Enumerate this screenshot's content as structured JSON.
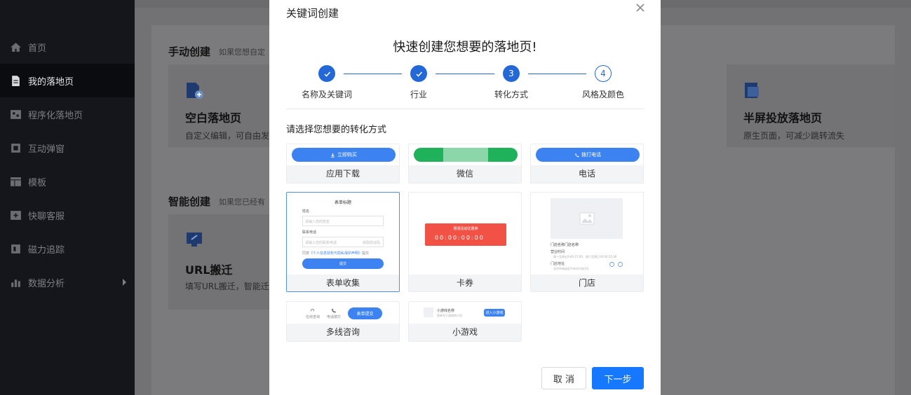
{
  "sidebar": {
    "items": [
      {
        "label": "首页",
        "icon": "home-icon"
      },
      {
        "label": "我的落地页",
        "icon": "document-icon"
      },
      {
        "label": "程序化落地页",
        "icon": "program-icon"
      },
      {
        "label": "互动弹窗",
        "icon": "popup-icon"
      },
      {
        "label": "模板",
        "icon": "template-icon"
      },
      {
        "label": "快聊客服",
        "icon": "chat-service-icon"
      },
      {
        "label": "磁力追踪",
        "icon": "tracking-icon"
      },
      {
        "label": "数据分析",
        "icon": "bar-chart-icon"
      }
    ]
  },
  "background": {
    "manual_title": "手动创建",
    "manual_sub": "如果您想自定",
    "blank_title": "空白落地页",
    "blank_desc": "自定义编辑，可自由发",
    "half_title": "半屏投放落地页",
    "half_desc": "原生页面，可减少跳转流失",
    "smart_title": "智能创建",
    "smart_sub": "如果您已经有",
    "url_title": "URL搬迁",
    "url_desc": "填写URL搬迁，智能迁"
  },
  "modal": {
    "title": "关键词创建",
    "headline": "快速创建您想要的落地页!",
    "steps": [
      {
        "label": "名称及关键词",
        "state": "done",
        "num": "1"
      },
      {
        "label": "行业",
        "state": "done",
        "num": "2"
      },
      {
        "label": "转化方式",
        "state": "current",
        "num": "3"
      },
      {
        "label": "风格及颜色",
        "state": "todo",
        "num": "4"
      }
    ],
    "prompt": "请选择您想要的转化方式",
    "options": {
      "app_download": {
        "label": "应用下载",
        "preview_button": "立即购买"
      },
      "wechat": {
        "label": "微信"
      },
      "phone": {
        "label": "电话",
        "preview_button": "拨打电话"
      },
      "form": {
        "label": "表单收集",
        "preview_title": "表单标题",
        "field1_label": "姓名",
        "field1_placeholder": "请输入您的姓名",
        "field2_label": "联系电话",
        "field2_placeholder": "请输入您的联系电话",
        "field2_code": "获取验证码",
        "agree_prefix": "同意",
        "agree_link": "《个人信息授权与隐私保护声明》",
        "agree_suffix": "提交",
        "submit": "提交"
      },
      "coupon": {
        "label": "卡券",
        "preview_title": "限领活动优惠券",
        "timer": "00:00:00:00"
      },
      "store": {
        "label": "门店",
        "store_name": "门店名称门店名称",
        "hours_label": "营业时间",
        "hours_text": "周一至周五9:00-21:00，周六至周日10:00-21:00",
        "address_label": "门店地址",
        "address_text": "北京市海淀区中关村大街1号"
      },
      "multiline": {
        "label": "多线咨询",
        "opt1": "在线咨询",
        "opt2": "电话拨打",
        "btn": "表单提交"
      },
      "minigame": {
        "label": "小游戏",
        "name": "小游戏名称",
        "desc": "简单写小游戏的介绍",
        "btn": "进入小游戏"
      }
    },
    "cancel": "取 消",
    "next": "下一步"
  },
  "colors": {
    "primary": "#1677ff",
    "step": "#2468d8",
    "wechat": "#1fb25a",
    "coupon": "#f25246"
  }
}
